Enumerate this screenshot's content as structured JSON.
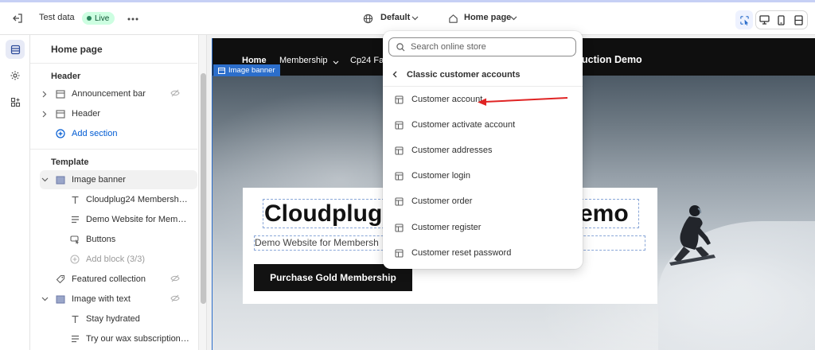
{
  "topbar": {
    "store_name": "Test data",
    "status_badge": "Live",
    "theme_selector": "Default",
    "page_selector": "Home page"
  },
  "panel": {
    "title": "Home page",
    "header_section": {
      "title": "Header",
      "items": [
        "Announcement bar",
        "Header"
      ],
      "add_label": "Add section"
    },
    "template_section": {
      "title": "Template",
      "image_banner": "Image banner",
      "banner_blocks": [
        "Cloudplug24 Membership ...",
        "Demo Website for Member...",
        "Buttons"
      ],
      "add_block": "Add block (3/3)",
      "featured_collection": "Featured collection",
      "image_with_text": "Image with text",
      "iwt_blocks": [
        "Stay hydrated",
        "Try our wax subscription so..."
      ]
    }
  },
  "preview": {
    "nav": [
      "Home",
      "Membership",
      "Cp24 Fa"
    ],
    "brand_fragment": "uction Demo",
    "selection_tag": "Image banner",
    "card": {
      "title": "Cloudplug",
      "title_end": "emo",
      "subtitle": "Demo Website for Membersh",
      "button": "Purchase Gold Membership"
    }
  },
  "dropdown": {
    "search_placeholder": "Search online store",
    "category": "Classic customer accounts",
    "items": [
      "Customer account",
      "Customer activate account",
      "Customer addresses",
      "Customer login",
      "Customer order",
      "Customer register",
      "Customer reset password"
    ]
  },
  "colors": {
    "accent_blue": "#005bd3",
    "live_badge_bg": "#cdfee1",
    "annotation_arrow": "#e02424",
    "selection_blue": "#2c6ecb"
  }
}
